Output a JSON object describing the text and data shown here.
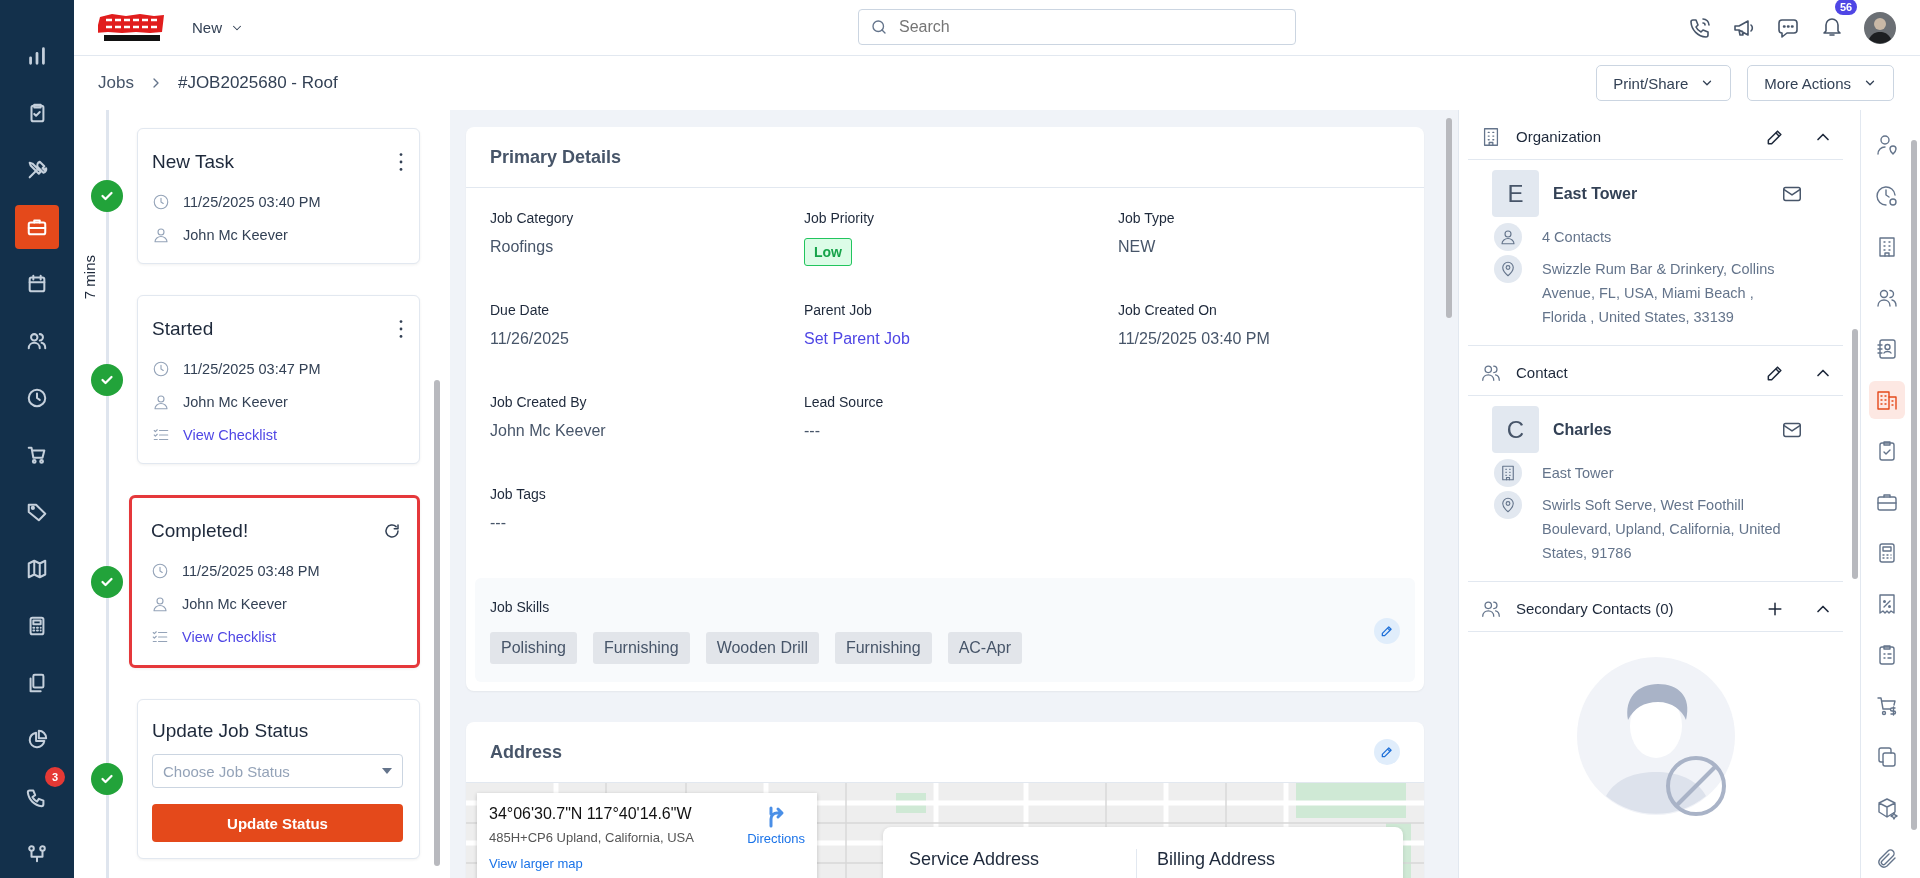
{
  "nav": {
    "items": [
      {
        "kind": "chart",
        "selected": false
      },
      {
        "kind": "clipboard",
        "selected": false
      },
      {
        "kind": "tools",
        "selected": false
      },
      {
        "kind": "briefcase",
        "selected": true
      },
      {
        "kind": "calendar",
        "selected": false
      },
      {
        "kind": "users",
        "selected": false
      },
      {
        "kind": "clock",
        "selected": false
      },
      {
        "kind": "cart",
        "selected": false
      },
      {
        "kind": "tag",
        "selected": false
      },
      {
        "kind": "map",
        "selected": false
      },
      {
        "kind": "calculator",
        "selected": false
      },
      {
        "kind": "documents",
        "selected": false
      },
      {
        "kind": "pie",
        "selected": false
      },
      {
        "kind": "phonechat",
        "selected": false,
        "badge": "3"
      },
      {
        "kind": "orgchart",
        "selected": false
      }
    ]
  },
  "header": {
    "menu": "New",
    "search": {
      "placeholder": "Search"
    },
    "notifications": "56"
  },
  "breadcrumb": {
    "parent": "Jobs",
    "current": "#JOB2025680 - Roof"
  },
  "actions": [
    "Print/Share",
    "More Actions"
  ],
  "timeline": {
    "duration": "7 mins",
    "steps": [
      {
        "title": "New Task",
        "kind": "menu",
        "highlighted": false,
        "time": "11/25/2025 03:40 PM",
        "user": "John Mc Keever"
      },
      {
        "title": "Started",
        "kind": "menu",
        "highlighted": false,
        "time": "11/25/2025 03:47 PM",
        "user": "John Mc Keever",
        "checklist": "View Checklist"
      },
      {
        "title": "Completed!",
        "kind": "reopen",
        "highlighted": true,
        "time": "11/25/2025 03:48 PM",
        "user": "John Mc Keever",
        "checklist": "View Checklist"
      }
    ],
    "update": {
      "title": "Update Job Status",
      "placeholder": "Choose Job Status",
      "button": "Update Status"
    }
  },
  "primary_details": {
    "title": "Primary Details",
    "rows": [
      [
        {
          "label": "Job Category",
          "value": "Roofings",
          "kind": "text"
        },
        {
          "label": "Job Priority",
          "value": "Low",
          "kind": "badge"
        },
        {
          "label": "Job Type",
          "value": "NEW",
          "kind": "text"
        }
      ],
      [
        {
          "label": "Due Date",
          "value": "11/26/2025",
          "kind": "text"
        },
        {
          "label": "Parent Job",
          "value": "Set Parent Job",
          "kind": "link"
        },
        {
          "label": "Job Created On",
          "value": "11/25/2025 03:40 PM",
          "kind": "text"
        }
      ],
      [
        {
          "label": "Job Created By",
          "value": "John Mc Keever",
          "kind": "text"
        },
        {
          "label": "Lead Source",
          "value": "---",
          "kind": "text"
        }
      ],
      [
        {
          "label": "Job Tags",
          "value": "---",
          "kind": "text"
        }
      ]
    ],
    "skills": {
      "label": "Job Skills",
      "tags": [
        "Polishing",
        "Furnishing",
        "Wooden Drill",
        "Furnishing",
        "AC-Apr"
      ]
    }
  },
  "address": {
    "title": "Address",
    "map_card": {
      "coordinates": "34°06'30.7\"N 117°40'14.6\"W",
      "plus_code": "485H+CP6 Upland, California, USA",
      "directions": "Directions",
      "larger_map": "View larger map"
    },
    "columns": [
      "Service Address",
      "Billing Address"
    ]
  },
  "organization": {
    "title": "Organization",
    "initial": "E",
    "name": "East Tower",
    "contacts": "4 Contacts",
    "address": "Swizzle Rum Bar & Drinkery, Collins Avenue, FL, USA, Miami Beach , Florida , United States, 33139"
  },
  "contact": {
    "title": "Contact",
    "initial": "C",
    "name": "Charles",
    "organization": "East Tower",
    "address": "Swirls Soft Serve, West Foothill Boulevard, Upland, California, United States, 91786"
  },
  "secondary_contacts": {
    "title": "Secondary Contacts (0)"
  },
  "tool_strip": {
    "items": [
      {
        "kind": "userpin",
        "selected": false
      },
      {
        "kind": "clockgear",
        "selected": false
      },
      {
        "kind": "building",
        "selected": false
      },
      {
        "kind": "users",
        "selected": false
      },
      {
        "kind": "contactbook",
        "selected": false
      },
      {
        "kind": "buildings",
        "selected": true
      },
      {
        "kind": "clipcheck",
        "selected": false
      },
      {
        "kind": "briefcase",
        "selected": false
      },
      {
        "kind": "calculator",
        "selected": false
      },
      {
        "kind": "receipt",
        "selected": false
      },
      {
        "kind": "cliplist",
        "selected": false
      },
      {
        "kind": "cartdollar",
        "selected": false
      },
      {
        "kind": "copy",
        "selected": false
      },
      {
        "kind": "box",
        "selected": false
      },
      {
        "kind": "clip",
        "selected": false
      }
    ]
  }
}
